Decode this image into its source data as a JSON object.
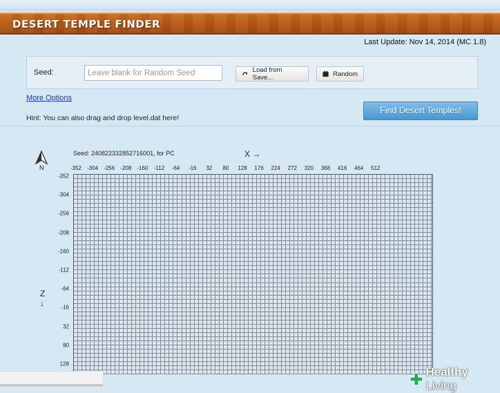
{
  "header": {
    "title": "DESERT TEMPLE FINDER",
    "last_update": "Last Update: Nov 14, 2014 (MC 1.8)"
  },
  "seed_form": {
    "label": "Seed:",
    "input_value": "",
    "input_placeholder": "Leave blank for Random Seed",
    "load_button_label": "Load from Save...",
    "random_button_label": "Random"
  },
  "more_options_link": "More Options",
  "find_button_label": "Find Desert Temples!",
  "hint": "Hint: You can also drag and drop level.dat here!",
  "map": {
    "compass_label": "N",
    "seed_text": "Seed: 240822332852716001, for PC",
    "x_axis_label": "X →",
    "z_axis_label": "Z ↓",
    "x_ticks": [
      "-352",
      "-304",
      "-256",
      "-208",
      "-160",
      "-112",
      "-64",
      "-16",
      "32",
      "80",
      "128",
      "176",
      "224",
      "272",
      "320",
      "368",
      "416",
      "464",
      "512"
    ],
    "z_ticks": [
      "-352",
      "-304",
      "-256",
      "-208",
      "-160",
      "-112",
      "-64",
      "-16",
      "32",
      "80",
      "128"
    ],
    "grid_color": "#7f8d99",
    "grid_background": "#dde6ee"
  },
  "watermark": {
    "brand_bold": "Healthy",
    "brand_light": " Living",
    "accent_color": "#2fa65a"
  }
}
